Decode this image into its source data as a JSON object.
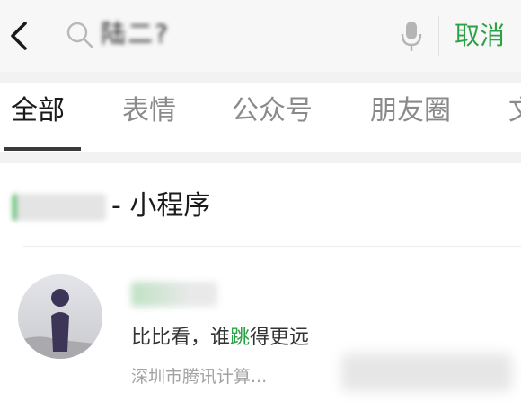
{
  "search": {
    "query": "陆二?",
    "cancel_label": "取消"
  },
  "tabs": [
    {
      "label": "全部",
      "active": true
    },
    {
      "label": "表情",
      "active": false
    },
    {
      "label": "公众号",
      "active": false
    },
    {
      "label": "朋友圈",
      "active": false
    },
    {
      "label": "文",
      "active": false
    }
  ],
  "section": {
    "title_suffix": "- 小程序"
  },
  "result": {
    "desc_before": "比比看，谁",
    "desc_highlight": "跳",
    "desc_after": "得更远",
    "org": "深圳市腾讯计算..."
  },
  "colors": {
    "accent": "#2ba245",
    "background": "#f2f2f2",
    "muted": "#a3a3a3"
  },
  "icons": {
    "back": "back-chevron-icon",
    "search": "search-icon",
    "mic": "microphone-icon"
  }
}
